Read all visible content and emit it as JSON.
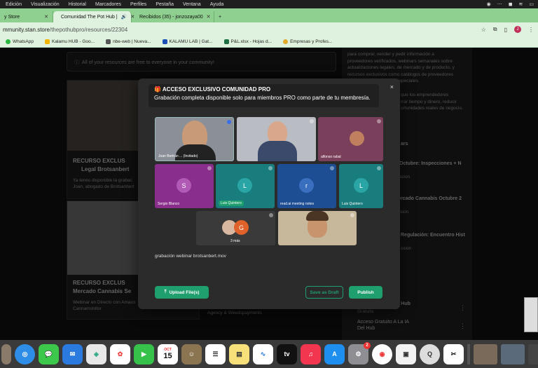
{
  "menubar": {
    "items": [
      "Edición",
      "Visualización",
      "Historial",
      "Marcadores",
      "Perfiles",
      "Pestaña",
      "Ventana",
      "Ayuda"
    ]
  },
  "tabs": [
    {
      "label": "y Store"
    },
    {
      "label": "Comunidad The Pot Hub |"
    },
    {
      "label": "Recibidos (35) - jonzozaya00"
    }
  ],
  "address": {
    "host": "mmunity.stan.store",
    "path": "/thepothubpro/resources/22304",
    "profile_initial": "J"
  },
  "bookmarks": [
    "WhatsApp",
    "Kalamu HUB - Goo...",
    "nbe-web | Nueva...",
    "KALAMU LAB | Gat...",
    "P&L.xlsx - Hojas d...",
    "Empresas y Profes..."
  ],
  "page": {
    "info": "All of your resources are free to everyone in your community!",
    "card1_title": "RECURSO EXCLUS",
    "card1_sub": "Legal Brotsanbert",
    "card1_desc": [
      "Ya tenés disponible la grabac",
      "Joan, abogado de Brotsanbert"
    ],
    "card2_title": "RECURSO EXCLUS",
    "card2_sub": "Mercado Cannabis Se",
    "card2_desc": [
      "Webinar en Directo con Amaus",
      "Cannamonitor"
    ],
    "bottom_text": "Agency & Weedspayments"
  },
  "right_panel": {
    "desc": [
      "para comprar, vender y pedir información a",
      "proveedores verificados, webinars semanales sobre",
      "actualizaciones legales, de mercado y de producto, y",
      "recursos exclusivos como catálogos de proveedores",
      "y códigos de descuento especiales.",
      "",
      "que los emprendedores",
      "rrar tiempo y dinero, reducir",
      "ortunidades reales de negocio."
    ],
    "heading": "ars",
    "items": [
      {
        "title": "Octubre: Inspecciones + N",
        "sub": "ssion"
      },
      {
        "title": "ercado Cannabis Octubre 2",
        "sub": "ssion"
      },
      {
        "title": "Regulación: Encuentro Hist",
        "sub": "ssion"
      }
    ],
    "bottom1": "t Hub",
    "bottom1b": "Gratuita",
    "bottom2": "Acceso Gratuito A La IA",
    "bottom2b": "Del Hub"
  },
  "modal": {
    "banner_title": "ACCESO EXCLUSIVO COMUNIDAD PRO",
    "banner_sub": "Grabación completa disponible solo para miembros PRO como parte de tu membresía.",
    "close": "×",
    "participants": [
      {
        "name": "Joan Bertrán ... (Invitado)",
        "initial": ""
      },
      {
        "name": "",
        "initial": ""
      },
      {
        "name": "alfonso rabal",
        "initial": ""
      },
      {
        "name": "Sergio Blanco",
        "initial": "S"
      },
      {
        "name": "Luis Quintero",
        "initial": "L"
      },
      {
        "name": "read.ai meeting notes",
        "initial": "r"
      },
      {
        "name": "Luis Quintero",
        "initial": "L"
      },
      {
        "name": "3 más",
        "initial": "G"
      },
      {
        "name": "",
        "initial": ""
      }
    ],
    "file_name": "grabación webinar brotsanbert.mov",
    "upload_label": "Upload File(s)",
    "draft_label": "Save as Draft",
    "publish_label": "Publish"
  },
  "dock": {
    "calendar_month": "OCT",
    "calendar_day": "15",
    "settings_badge": "2"
  },
  "colors": {
    "accent": "#1f9e6e",
    "tab_green": "#8fcf8f"
  }
}
